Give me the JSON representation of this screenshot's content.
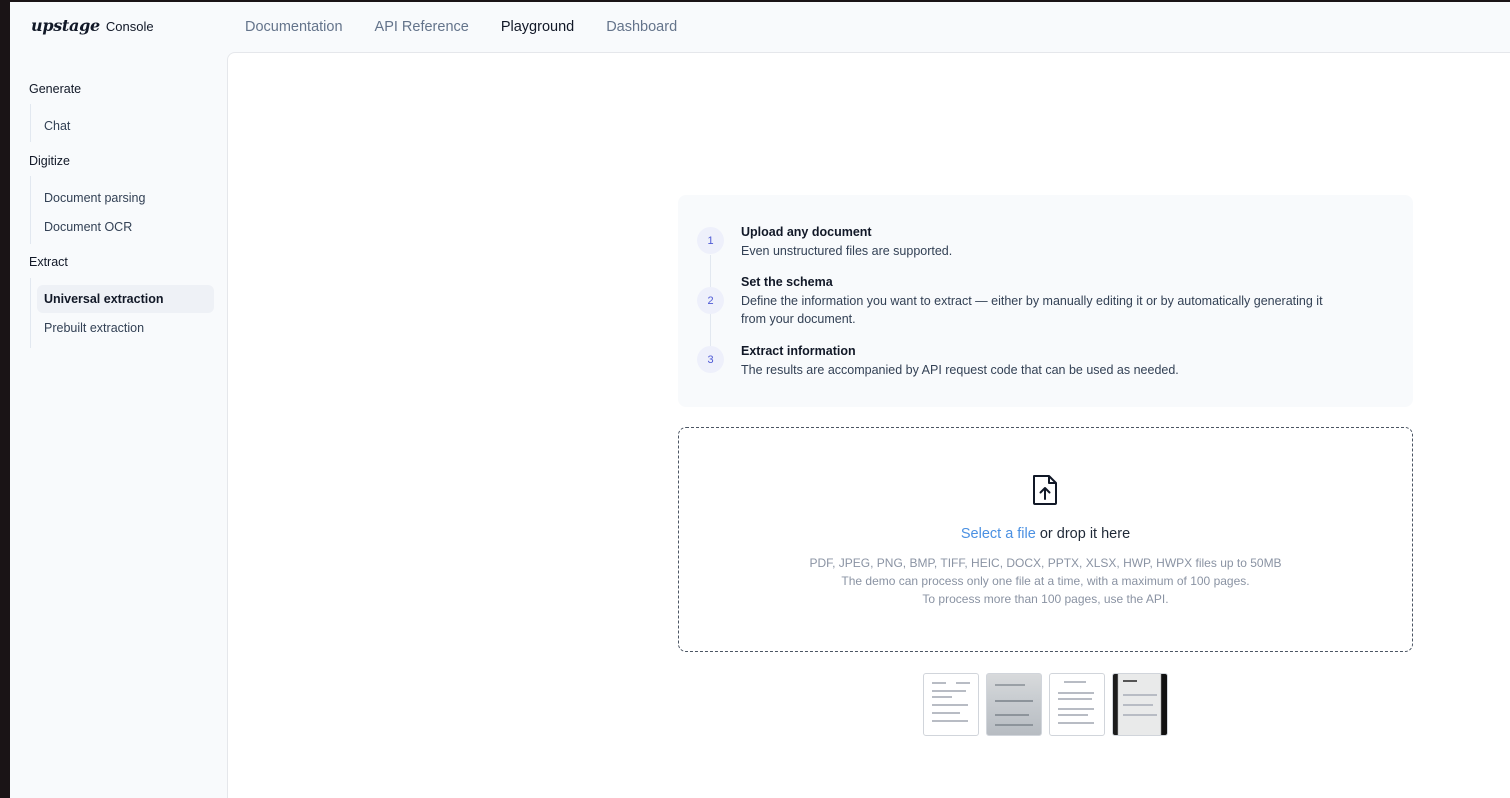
{
  "brand": {
    "mark": "upstage",
    "product": "Console"
  },
  "topnav": {
    "items": [
      {
        "label": "Documentation"
      },
      {
        "label": "API Reference"
      },
      {
        "label": "Playground"
      },
      {
        "label": "Dashboard"
      }
    ],
    "active": "Playground"
  },
  "sidebar": {
    "groups": [
      {
        "title": "Generate",
        "items": [
          {
            "label": "Chat"
          }
        ]
      },
      {
        "title": "Digitize",
        "items": [
          {
            "label": "Document parsing"
          },
          {
            "label": "Document OCR"
          }
        ]
      },
      {
        "title": "Extract",
        "items": [
          {
            "label": "Universal extraction"
          },
          {
            "label": "Prebuilt extraction"
          }
        ]
      }
    ],
    "active": "Universal extraction"
  },
  "steps": [
    {
      "num": "1",
      "title": "Upload any document",
      "desc": "Even unstructured files are supported."
    },
    {
      "num": "2",
      "title": "Set the schema",
      "desc": "Define the information you want to extract — either by manually editing it or by automatically generating it from your document."
    },
    {
      "num": "3",
      "title": "Extract information",
      "desc": "The results are accompanied by API request code that can be used as needed."
    }
  ],
  "dropzone": {
    "icon": "file-upload-icon",
    "select_label": "Select a file",
    "drop_label": " or drop it here",
    "formats": "PDF, JPEG, PNG, BMP, TIFF, HEIC, DOCX, PPTX, XLSX, HWP, HWPX files up to 50MB",
    "limit": "The demo can process only one file at a time, with a maximum of 100 pages.",
    "api_note": "To process more than 100 pages, use the API."
  },
  "samples": [
    {
      "name": "sample-document-1"
    },
    {
      "name": "sample-document-2"
    },
    {
      "name": "sample-document-3"
    },
    {
      "name": "sample-document-4"
    }
  ],
  "colors": {
    "link": "#4a90e2",
    "step_accent": "#4f5bd5",
    "active_bg": "#eef1f6"
  }
}
